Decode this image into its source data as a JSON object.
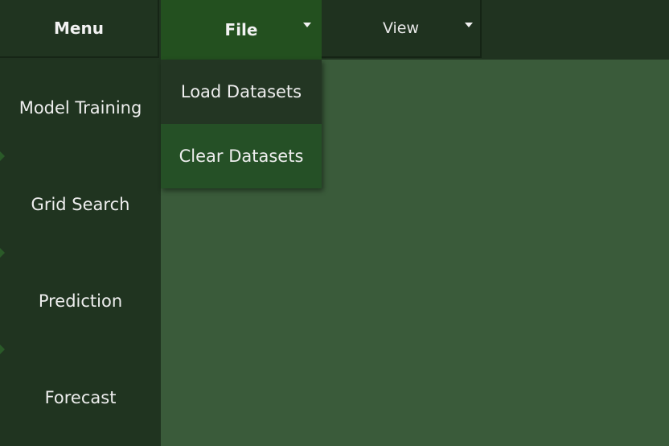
{
  "topbar": {
    "menu_label": "Menu",
    "file_label": "File",
    "view_label": "View"
  },
  "file_menu": {
    "items": [
      {
        "label": "Load Datasets"
      },
      {
        "label": "Clear Datasets"
      }
    ]
  },
  "sidebar": {
    "items": [
      {
        "label": "Model Training"
      },
      {
        "label": "Grid Search"
      },
      {
        "label": "Prediction"
      },
      {
        "label": "Forecast"
      }
    ]
  },
  "colors": {
    "bar_bg": "#203320",
    "active_menu": "#23501f",
    "content_bg": "#3a5b3a",
    "dropdown_hover": "#255026"
  },
  "icons": {
    "file_caret": "caret-down-icon",
    "view_caret": "caret-down-icon"
  }
}
